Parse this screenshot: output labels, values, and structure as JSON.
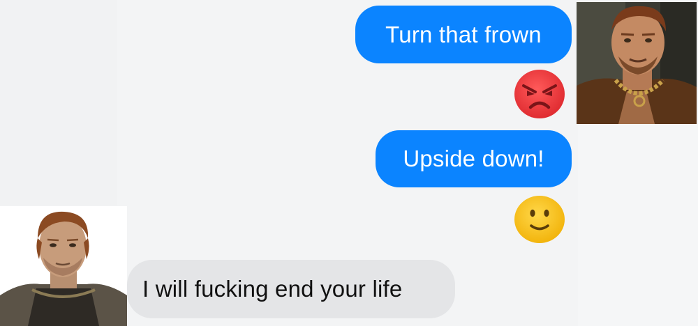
{
  "thread": {
    "messages": [
      {
        "direction": "outgoing",
        "text": "Turn that frown"
      },
      {
        "direction": "outgoing",
        "emoji": "angry-face-icon"
      },
      {
        "direction": "outgoing",
        "text": "Upside down!"
      },
      {
        "direction": "outgoing",
        "emoji": "smiling-face-icon"
      },
      {
        "direction": "incoming",
        "text": "I will fucking end your life"
      }
    ]
  },
  "colors": {
    "background": "#f3f4f5",
    "sent_bubble": "#0b84ff",
    "sent_text": "#ffffff",
    "received_bubble": "#e4e5e7",
    "received_text": "#111111",
    "angry_emoji": "#e8373b",
    "smile_emoji": "#f7c21c"
  },
  "avatars": {
    "sender": "sender-avatar",
    "receiver": "receiver-avatar"
  }
}
